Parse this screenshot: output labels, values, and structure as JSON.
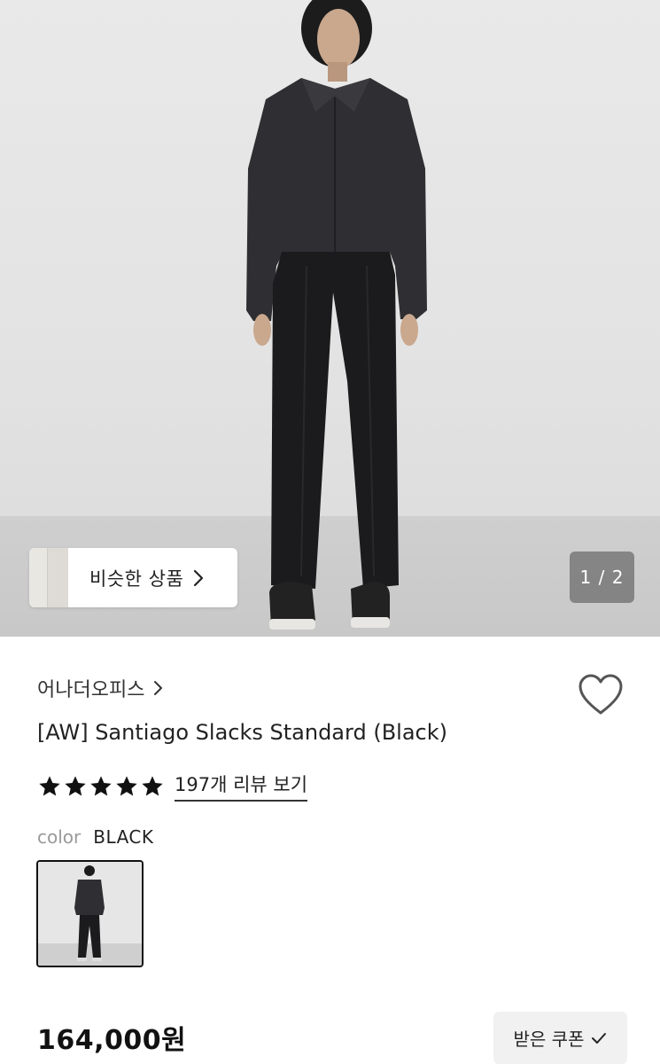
{
  "gallery": {
    "similar_products_label": "비슷한 상품",
    "page_indicator": "1 / 2"
  },
  "product": {
    "brand": "어나더오피스",
    "title": "[AW] Santiago Slacks Standard (Black)",
    "rating_stars": 5,
    "review_link": "197개 리뷰 보기",
    "color_label": "color",
    "color_value": "BLACK",
    "price": "164,000원"
  },
  "actions": {
    "coupon_label": "받은 쿠폰"
  },
  "colors": {
    "text_primary": "#111111",
    "text_muted": "#999999",
    "pager_bg": "#787878",
    "coupon_bg": "#f1f1f1"
  },
  "icons": {
    "similar_chevron": "chevron-right-icon",
    "brand_chevron": "chevron-right-icon",
    "wishlist": "heart-outline-icon",
    "star": "star-filled-icon",
    "coupon_check": "check-icon"
  }
}
